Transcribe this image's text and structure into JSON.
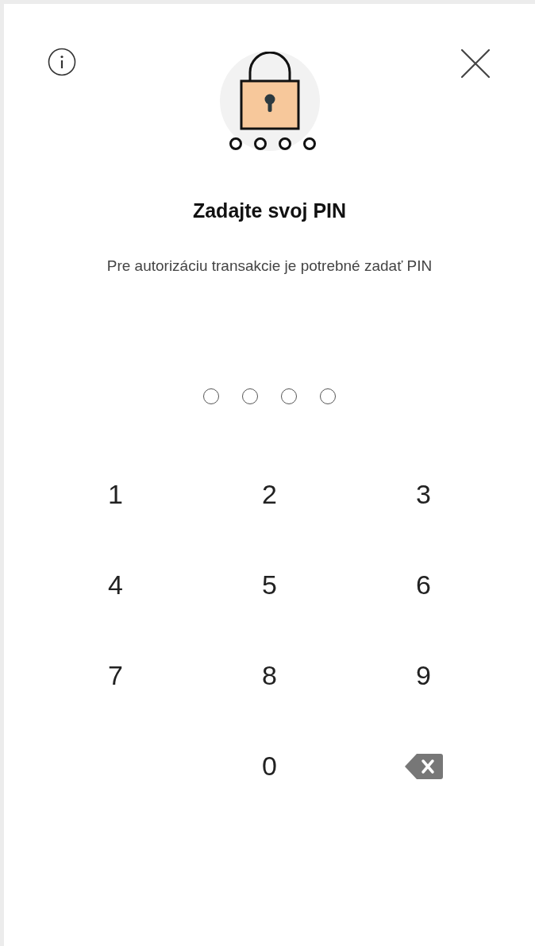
{
  "title": "Zadajte svoj PIN",
  "subtitle": "Pre autorizáciu transakcie je potrebné zadať PIN",
  "pin_dots": [
    {
      "filled": false
    },
    {
      "filled": false
    },
    {
      "filled": false
    },
    {
      "filled": false
    }
  ],
  "keypad": [
    {
      "kind": "digit",
      "label": "1"
    },
    {
      "kind": "digit",
      "label": "2"
    },
    {
      "kind": "digit",
      "label": "3"
    },
    {
      "kind": "digit",
      "label": "4"
    },
    {
      "kind": "digit",
      "label": "5"
    },
    {
      "kind": "digit",
      "label": "6"
    },
    {
      "kind": "digit",
      "label": "7"
    },
    {
      "kind": "digit",
      "label": "8"
    },
    {
      "kind": "digit",
      "label": "9"
    },
    {
      "kind": "blank"
    },
    {
      "kind": "digit",
      "label": "0"
    },
    {
      "kind": "backspace"
    }
  ]
}
